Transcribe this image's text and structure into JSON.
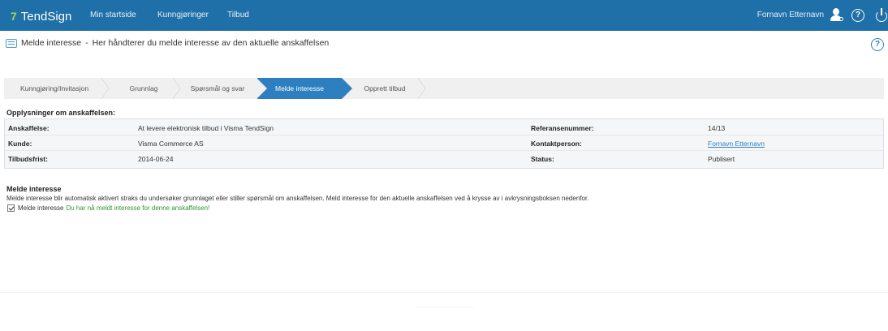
{
  "nav": {
    "brand": "TendSign",
    "items": [
      "Min startside",
      "Kunngjøringer",
      "Tilbud"
    ],
    "user": "Fornavn Etternavn",
    "accent": "#1f6fa8"
  },
  "header": {
    "title": "Melde interesse",
    "separator": "-",
    "subtitle": "Her håndterer du melde interesse av den aktuelle anskaffelsen"
  },
  "steps": [
    {
      "label": "Kunngjøring/Invitasjon",
      "active": false
    },
    {
      "label": "Grunnlag",
      "active": false
    },
    {
      "label": "Spørsmål og svar",
      "active": false
    },
    {
      "label": "Melde interesse",
      "active": true
    },
    {
      "label": "Opprett tilbud",
      "active": false
    }
  ],
  "info": {
    "title": "Opplysninger om anskaffelsen:",
    "rows": [
      {
        "label": "Anskaffelse:",
        "value": "At levere elektronisk tilbud i Visma TendSign",
        "label2": "Referansenummer:",
        "value2": "14/13"
      },
      {
        "label": "Kunde:",
        "value": "Visma Commerce AS",
        "label2": "Kontaktperson:",
        "value2": "Fornavn Etternavn"
      },
      {
        "label": "Tilbudsfrist:",
        "value": "2014-06-24",
        "label2": "Status:",
        "value2": "Publisert"
      }
    ]
  },
  "interest": {
    "title": "Melde interesse",
    "description": "Melde interesse blir automatisk aktivert straks du undersøker grunnlaget eller stiller spørsmål om anskaffelsen. Meld interesse for den aktuelle anskaffelsen ved å krysse av i avkrysningsboksen nedenfor.",
    "checkbox_label": "Melde interesse",
    "checked": true,
    "confirmation": "Du har nå meldt interesse for denne anskaffelsen!"
  },
  "icons": {
    "user": "user-settings-icon",
    "help": "help-icon",
    "power": "power-icon",
    "document": "document-icon"
  }
}
